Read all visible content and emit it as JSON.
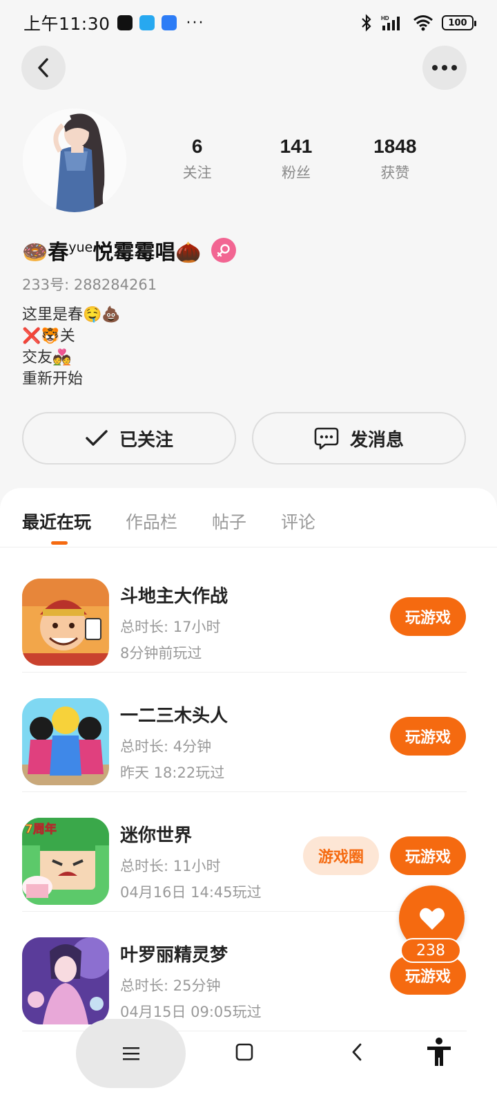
{
  "status_bar": {
    "time": "上午11:30",
    "more": "···",
    "battery": "100"
  },
  "profile": {
    "stats": [
      {
        "value": "6",
        "label": "关注"
      },
      {
        "value": "141",
        "label": "粉丝"
      },
      {
        "value": "1848",
        "label": "获赞"
      }
    ],
    "name_prefix": "🍩春",
    "name_sup": "yue",
    "name_suffix": "悦霉霉唱🌰",
    "uid": "233号: 288284261",
    "bio_lines": [
      "这里是春🤤💩",
      "❌🐯关",
      "交友💑",
      "重新开始"
    ],
    "follow_label": "已关注",
    "message_label": "发消息"
  },
  "tabs": [
    "最近在玩",
    "作品栏",
    "帖子",
    "评论"
  ],
  "games": [
    {
      "name": "斗地主大作战",
      "duration": "总时长: 17小时",
      "last_played": "8分钟前玩过",
      "play_label": "玩游戏"
    },
    {
      "name": "一二三木头人",
      "duration": "总时长: 4分钟",
      "last_played": "昨天 18:22玩过",
      "play_label": "玩游戏"
    },
    {
      "name": "迷你世界",
      "duration": "总时长: 11小时",
      "last_played": "04月16日 14:45玩过",
      "play_label": "玩游戏",
      "circle_label": "游戏圈",
      "icon_badge": "7周年"
    },
    {
      "name": "叶罗丽精灵梦",
      "duration": "总时长: 25分钟",
      "last_played": "04月15日 09:05玩过",
      "play_label": "玩游戏"
    }
  ],
  "like": {
    "count": "238"
  },
  "colors": {
    "accent": "#f56a10",
    "accent_light": "#fde6d5",
    "female": "#f26592"
  }
}
